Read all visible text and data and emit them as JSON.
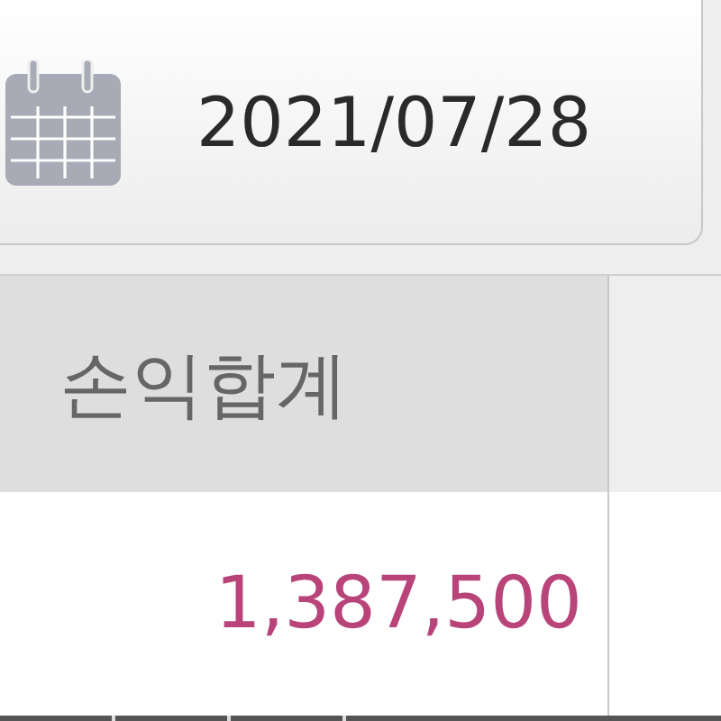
{
  "date_picker": {
    "value": "2021/07/28"
  },
  "table": {
    "columns": [
      {
        "label": "손익합계"
      }
    ],
    "rows": [
      {
        "cells": [
          "1,387,500"
        ]
      }
    ]
  }
}
